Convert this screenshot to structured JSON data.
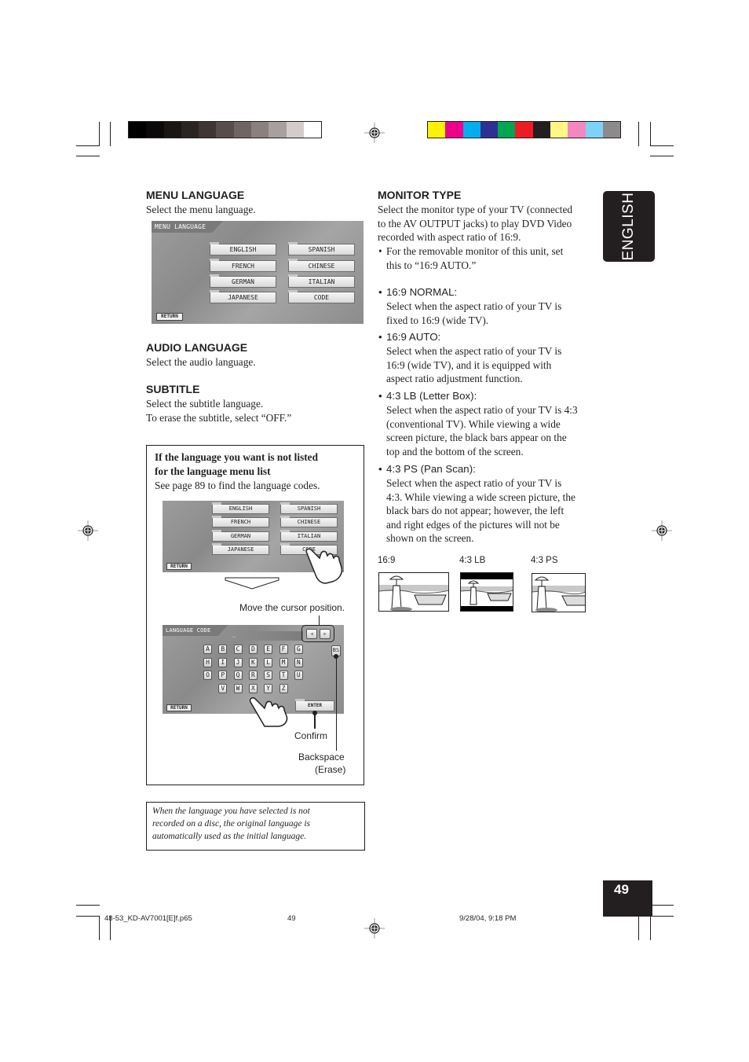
{
  "color_bars": {
    "grayscale": [
      "#000000",
      "#0b0909",
      "#1a1614",
      "#2a2422",
      "#3f3634",
      "#574e4c",
      "#6f6563",
      "#8a807e",
      "#a8a09f",
      "#d4cccb",
      "#ffffff"
    ],
    "process": [
      "#fff200",
      "#ec008c",
      "#00aeef",
      "#2e3192",
      "#00a651",
      "#ed1c24",
      "#231f20",
      "#fff685",
      "#f287c2",
      "#7dd3f7",
      "#8c8a8a"
    ]
  },
  "side_tab": {
    "label": "ENGLISH"
  },
  "left": {
    "menu_language": {
      "heading": "MENU LANGUAGE",
      "text": "Select the menu language.",
      "screen": {
        "title": "MENU LANGUAGE",
        "buttons": [
          "ENGLISH",
          "SPANISH",
          "FRENCH",
          "CHINESE",
          "GERMAN",
          "ITALIAN",
          "JAPANESE",
          "CODE"
        ],
        "return_label": "RETURN"
      }
    },
    "audio_language": {
      "heading": "AUDIO LANGUAGE",
      "text": "Select the audio language."
    },
    "subtitle": {
      "heading": "SUBTITLE",
      "text1": "Select the subtitle language.",
      "text2": "To erase the subtitle, select “OFF.”"
    },
    "code_box": {
      "title_line1": "If the language you want is not listed",
      "title_line2": "for the language menu list",
      "text": "See page 89 to find the language codes.",
      "screen1": {
        "buttons": [
          "ENGLISH",
          "SPANISH",
          "FRENCH",
          "CHINESE",
          "GERMAN",
          "ITALIAN",
          "JAPANESE",
          "CODE"
        ],
        "return_label": "RETURN"
      },
      "callout_cursor": "Move the cursor position.",
      "screen2": {
        "title": "LANGUAGE CODE",
        "input_value": "_",
        "keys": [
          "A",
          "B",
          "C",
          "D",
          "E",
          "F",
          "G",
          "H",
          "I",
          "J",
          "K",
          "L",
          "M",
          "N",
          "O",
          "P",
          "Q",
          "R",
          "S",
          "T",
          "U",
          "V",
          "W",
          "X",
          "Y",
          "Z"
        ],
        "bs_label": "BS",
        "enter_label": "ENTER",
        "return_label": "RETURN",
        "left_arrow": "◀",
        "right_arrow": "▶"
      },
      "callout_confirm": "Confirm",
      "callout_backspace1": "Backspace",
      "callout_backspace2": "(Erase)"
    },
    "note": {
      "line1": "When the language you have selected is not",
      "line2": "recorded on a disc, the original language is",
      "line3": "automatically used as the initial language."
    }
  },
  "right": {
    "monitor_type": {
      "heading": "MONITOR TYPE",
      "intro": [
        "Select the monitor type of your TV (connected",
        "to the AV OUTPUT jacks) to play DVD Video",
        "recorded with aspect ratio of 16:9."
      ],
      "note_bullet": [
        "For the removable monitor of this unit, set",
        "this to “16:9 AUTO.”"
      ],
      "options": [
        {
          "label": "16:9 NORMAL:",
          "lines": [
            "Select when the aspect ratio of your TV is",
            "fixed to 16:9 (wide TV)."
          ]
        },
        {
          "label": "16:9 AUTO:",
          "lines": [
            "Select when the aspect ratio of your TV is",
            "16:9 (wide TV), and it is equipped with",
            "aspect ratio adjustment function."
          ]
        },
        {
          "label": "4:3 LB (Letter Box):",
          "lines": [
            "Select when the aspect ratio of your TV is 4:3",
            "(conventional TV). While viewing a wide",
            "screen picture, the black bars appear on the",
            "top and the bottom of the screen."
          ]
        },
        {
          "label": "4:3 PS (Pan Scan):",
          "lines": [
            "Select when the aspect ratio of your TV is",
            "4:3. While viewing a wide screen picture, the",
            "black bars do not appear; however, the left",
            "and right edges of the pictures will not be",
            "shown on the screen."
          ]
        }
      ],
      "pictures": [
        {
          "label": "16:9"
        },
        {
          "label": "4:3 LB"
        },
        {
          "label": "4:3 PS"
        }
      ]
    }
  },
  "page_number": "49",
  "footer": {
    "file": "48-53_KD-AV7001[E]f.p65",
    "page": "49",
    "date": "9/28/04, 9:18 PM"
  }
}
